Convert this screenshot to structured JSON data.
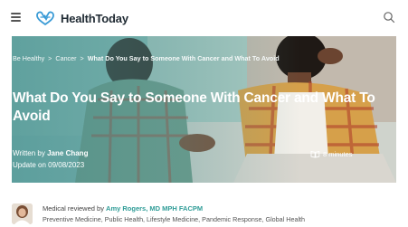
{
  "header": {
    "logo_text": "HealthToday",
    "menu_icon": "hamburger-icon",
    "search_icon": "search-icon",
    "brand_color": "#3a9bd6"
  },
  "hero": {
    "breadcrumb": {
      "items": [
        "Be Healthy",
        "Cancer",
        "What Do You Say to Someone With Cancer and What To Avoid"
      ],
      "separator": ">"
    },
    "title": "What Do You Say to Someone With Cancer and What To Avoid",
    "byline_prefix": "Written by",
    "author": "Jane Chang",
    "update_text": "Update on 09/08/2023",
    "read_time": "8 minutes"
  },
  "review": {
    "prefix": "Medical reviewed by",
    "reviewer": "Amy Rogers, MD MPH FACPM",
    "specialties": "Preventive Medicine, Public Health, Lifestyle Medicine, Pandemic Response, Global Health",
    "link_color": "#2f9c97"
  }
}
